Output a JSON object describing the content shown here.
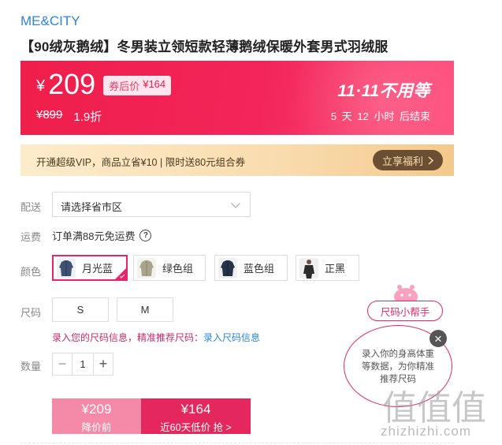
{
  "brand": "ME&CITY",
  "title": "【90绒灰鹅绒】冬男装立领短款轻薄鹅绒保暖外套男式羽绒服",
  "price": {
    "currency": "¥",
    "current": "209",
    "coupon_label": "券后价",
    "coupon_price": "¥164",
    "original": "¥899",
    "discount": "1.9折",
    "promo_logo": "11·11不用等",
    "countdown": "5 天 12 小时 后结束"
  },
  "vip": {
    "text": "开通超级VIP，商品立省¥10 | 限时送80元组合券",
    "button_label": "立享福利",
    "button_icon": "chevron-right-icon"
  },
  "delivery": {
    "label": "配送",
    "placeholder": "请选择省市区"
  },
  "shipping": {
    "label": "运费",
    "text": "订单满88元免运费",
    "help_icon": "?"
  },
  "colors": {
    "label": "颜色",
    "options": [
      {
        "label": "月光蓝",
        "selected": true,
        "swatch": "#3f5270"
      },
      {
        "label": "绿色组",
        "selected": false,
        "swatch": "#a9a48c"
      },
      {
        "label": "蓝色组",
        "selected": false,
        "swatch": "#263248"
      },
      {
        "label": "正黑",
        "selected": false,
        "swatch": "#2b2b2b"
      }
    ]
  },
  "sizes": {
    "label": "尺码",
    "options": [
      "S",
      "M"
    ],
    "hint": "录入您的尺码信息，精准推荐尺码：",
    "hint_link": "录入尺码信息"
  },
  "quantity": {
    "label": "数量",
    "minus": "−",
    "value": "1",
    "plus": "+"
  },
  "buy": {
    "left_price": "¥209",
    "left_sub": "降价前",
    "right_price": "¥164",
    "right_sub": "近60天低价 抢 >"
  },
  "size_helper": {
    "title": "尺码小帮手",
    "text": "录入你的身高体重等数据，为你精准推荐尺码",
    "close": "×"
  },
  "watermark": {
    "logo": "值值值",
    "url": "zhizhizhi.com"
  },
  "colors_theme": {
    "accent": "#e4266a",
    "banner_red": "#ef1e4a",
    "link_blue": "#2a86d8"
  }
}
